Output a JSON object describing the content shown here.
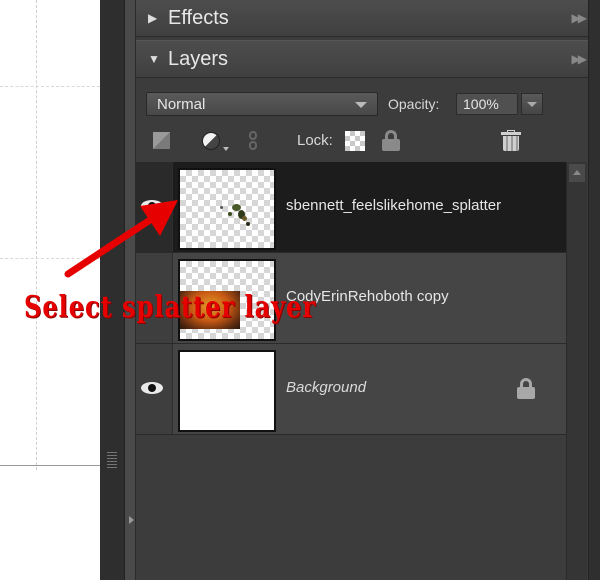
{
  "panels": {
    "effects": {
      "title": "Effects"
    },
    "layers": {
      "title": "Layers"
    }
  },
  "layers_options": {
    "blend_mode": "Normal",
    "opacity_label": "Opacity:",
    "opacity_value": "100%",
    "lock_label": "Lock:"
  },
  "layers": [
    {
      "name": "sbennett_feelslikehome_splatter",
      "selected": true,
      "visible": true,
      "locked": false
    },
    {
      "name": "CodyErinRehoboth copy",
      "selected": false,
      "visible": false,
      "locked": false
    },
    {
      "name": "Background",
      "selected": false,
      "visible": true,
      "locked": true
    }
  ],
  "annotation": {
    "text": "Select splatter layer",
    "color": "#e60000"
  },
  "colors": {
    "panel_bg": "#3c3c3c",
    "selected_row": "#1c1c1c"
  }
}
